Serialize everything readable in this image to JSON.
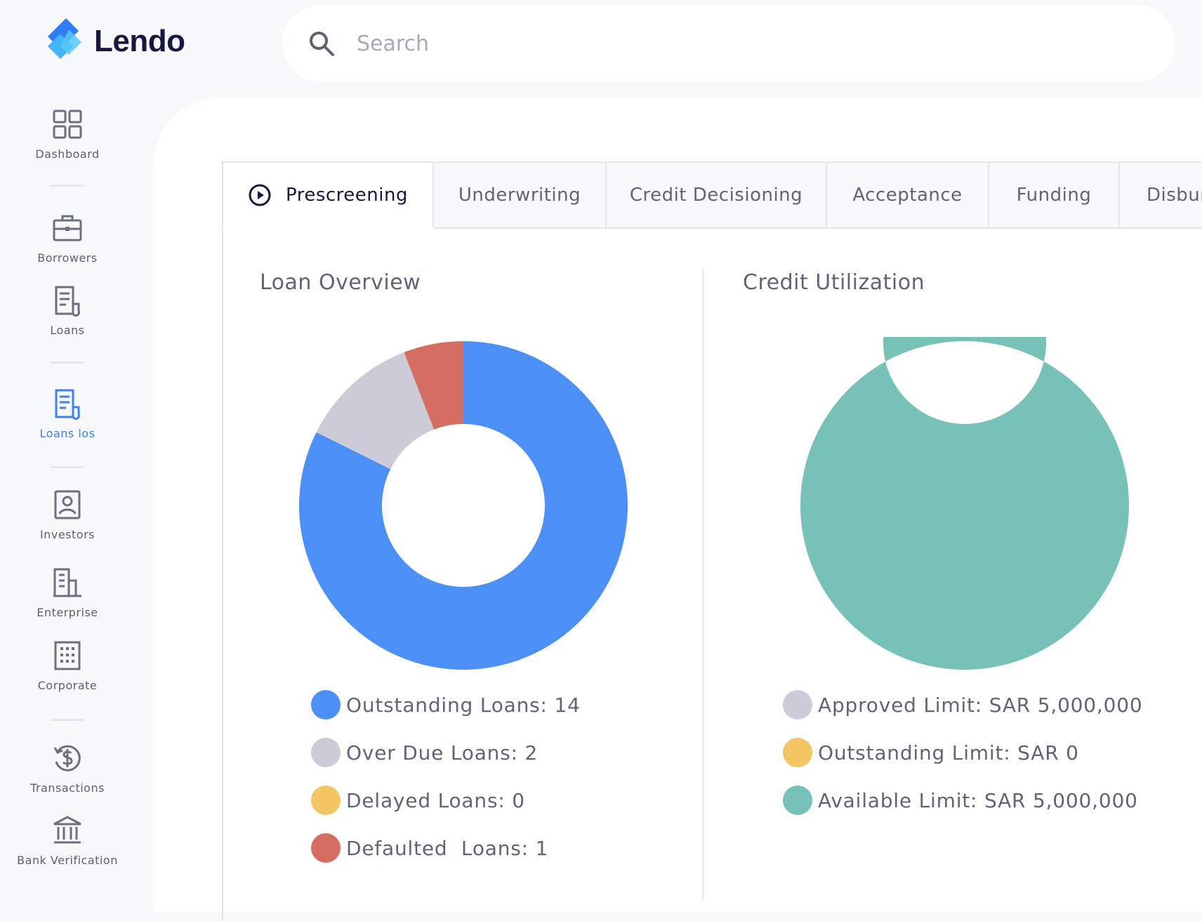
{
  "brand": {
    "name": "Lendo"
  },
  "search": {
    "placeholder": "Search"
  },
  "sidebar": {
    "items": [
      {
        "label": "Dashboard"
      },
      {
        "label": "Borrowers"
      },
      {
        "label": "Loans"
      },
      {
        "label": "Loans los"
      },
      {
        "label": "Investors"
      },
      {
        "label": "Enterprise"
      },
      {
        "label": "Corporate"
      },
      {
        "label": "Transactions"
      },
      {
        "label": "Bank Verification"
      }
    ]
  },
  "tabs": [
    {
      "label": "Prescreening",
      "active": true
    },
    {
      "label": "Underwriting"
    },
    {
      "label": "Credit Decisioning"
    },
    {
      "label": "Acceptance"
    },
    {
      "label": "Funding"
    },
    {
      "label": "Disbur"
    }
  ],
  "loan_overview": {
    "title": "Loan Overview",
    "legend": [
      {
        "label": "Outstanding Loans: 14",
        "color": "#4c8ff5"
      },
      {
        "label": "Over Due Loans: 2",
        "color": "#cccbd7"
      },
      {
        "label": "Delayed Loans: 0",
        "color": "#f4c563"
      },
      {
        "label": "Defaulted  Loans: 1",
        "color": "#d46e63"
      }
    ]
  },
  "credit_utilization": {
    "title": "Credit Utilization",
    "legend": [
      {
        "label": "Approved Limit: SAR 5,000,000",
        "color": "#cccbd7"
      },
      {
        "label": "Outstanding Limit: SAR 0",
        "color": "#f4c563"
      },
      {
        "label": "Available Limit: SAR 5,000,000",
        "color": "#77c1b6"
      }
    ]
  },
  "chart_data": [
    {
      "type": "pie",
      "title": "Loan Overview",
      "categories": [
        "Outstanding Loans",
        "Over Due Loans",
        "Delayed Loans",
        "Defaulted Loans"
      ],
      "values": [
        14,
        2,
        0,
        1
      ],
      "colors": [
        "#4c8ff5",
        "#cccbd7",
        "#f4c563",
        "#d46e63"
      ],
      "donut": true
    },
    {
      "type": "pie",
      "title": "Credit Utilization",
      "categories": [
        "Approved Limit",
        "Outstanding Limit",
        "Available Limit"
      ],
      "values": [
        0,
        0,
        5000000
      ],
      "colors": [
        "#cccbd7",
        "#f4c563",
        "#77c1b6"
      ],
      "donut": true
    }
  ]
}
